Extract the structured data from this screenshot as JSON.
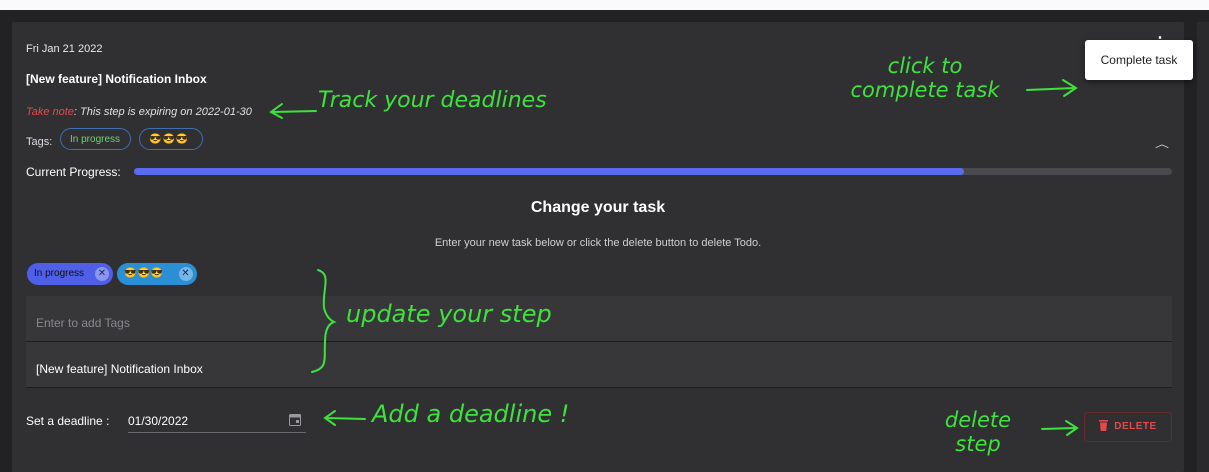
{
  "card": {
    "date": "Fri Jan 21 2022",
    "title": "[New feature] Notification Inbox",
    "note_prefix": "Take note",
    "note_text": ": This step is expiring on 2022-01-30",
    "tags_label": "Tags:",
    "tags": [
      "In progress",
      "😎😎😎"
    ],
    "menu_item": "Complete task",
    "progress_label": "Current Progress:",
    "progress": 0.8
  },
  "form": {
    "heading": "Change your task",
    "subheading": "Enter your new task below or click the delete button to delete Todo.",
    "chips": [
      "In progress",
      "😎😎😎"
    ],
    "tags_placeholder": "Enter to add Tags",
    "task_value": "[New feature] Notification Inbox",
    "deadline_label": "Set a deadline :",
    "deadline_value": "01/30/2022",
    "delete_label": "DELETE"
  },
  "annotations": {
    "track": "Track your deadlines",
    "complete": "click to complete task",
    "update": "update your step",
    "deadline": "Add a deadline !",
    "delete": "delete step"
  },
  "colors": {
    "accent": "#5b6bf0",
    "danger": "#e5484d",
    "annotation": "#3de23d",
    "card_bg": "#303033"
  }
}
